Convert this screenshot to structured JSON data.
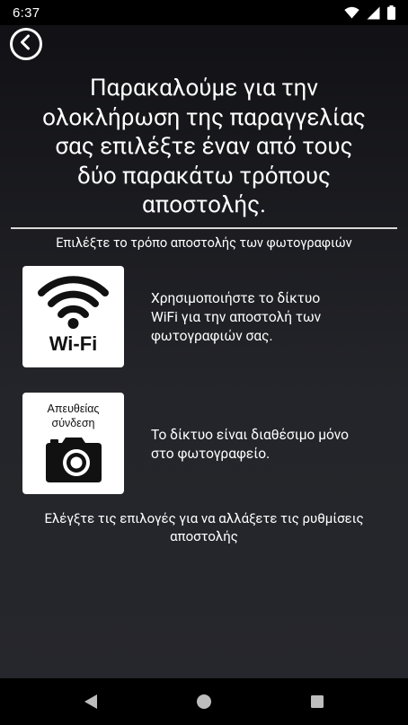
{
  "status_bar": {
    "time": "6:37",
    "icons": [
      "wifi-icon",
      "signal-icon",
      "battery-icon"
    ]
  },
  "header": {
    "back_icon": "back-arrow-icon",
    "title_lines": [
      "Παρακαλούμε για την",
      "ολοκλήρωση της παραγγελίας",
      "σας επιλέξτε έναν από τους",
      "δύο παρακάτω τρόπους",
      "αποστολής."
    ]
  },
  "subtitle": "Επιλέξτε το τρόπο αποστολής των φωτογραφιών",
  "options": [
    {
      "icon": "wifi-icon",
      "icon_label": "Wi-Fi",
      "description_lines": [
        "Χρησιμοποιήστε το δίκτυο",
        "WiFi για την αποστολή των",
        "φωτογραφιών σας."
      ]
    },
    {
      "icon": "camera-icon",
      "icon_label_lines": [
        "Απευθείας",
        "σύνδεση"
      ],
      "description_lines": [
        "Το δίκτυο είναι διαθέσιμο μόνο",
        "στο φωτογραφείο."
      ]
    }
  ],
  "footer_note_lines": [
    "Ελέγξτε τις επιλογές για να αλλάξετε τις ρυθμίσεις",
    "αποστολής"
  ],
  "nav_bar": {
    "icons": [
      "back-triangle-icon",
      "home-circle-icon",
      "recents-square-icon"
    ]
  },
  "colors": {
    "background_top": "#101014",
    "background_bottom": "#26272c",
    "text": "#ffffff",
    "icon_box": "#ffffff",
    "bars": "#000000"
  }
}
